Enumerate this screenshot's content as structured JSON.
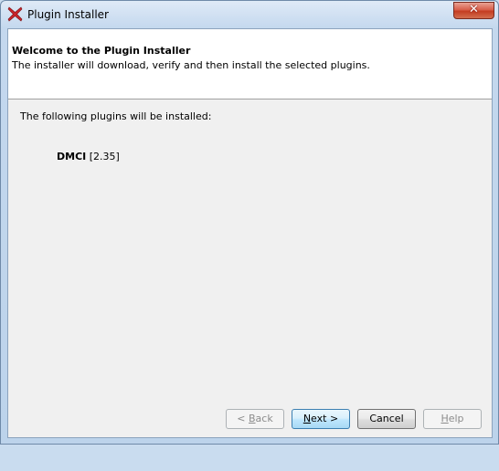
{
  "window": {
    "title": "Plugin Installer",
    "close_glyph": "✕"
  },
  "header": {
    "title": "Welcome to the Plugin Installer",
    "description": "The installer will download, verify and then install the selected plugins."
  },
  "content": {
    "intro": "The following plugins will be installed:",
    "plugins": [
      {
        "name": "DMCI",
        "version": "[2.35]"
      }
    ]
  },
  "buttons": {
    "back": {
      "prefix": "< ",
      "mnemonic": "B",
      "rest": "ack"
    },
    "next": {
      "mnemonic": "N",
      "rest": "ext >"
    },
    "cancel": "Cancel",
    "help": {
      "mnemonic": "H",
      "rest": "elp"
    }
  },
  "colors": {
    "app_icon": "#c8242b",
    "default_button_border": "#3c7fb1"
  }
}
